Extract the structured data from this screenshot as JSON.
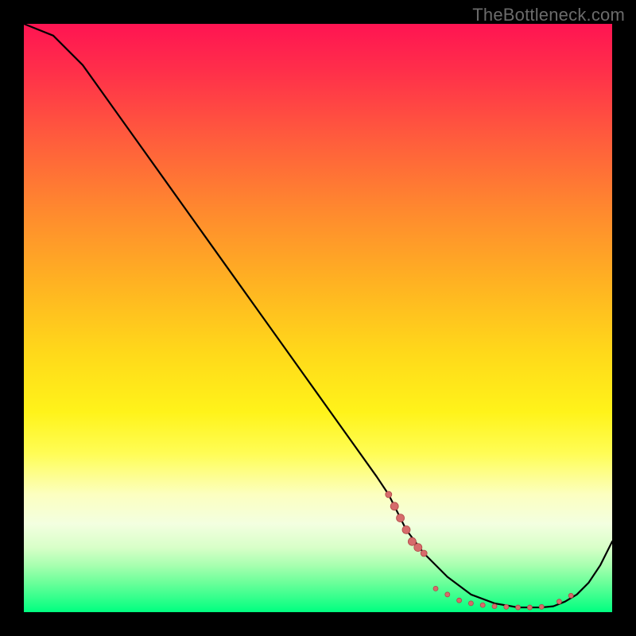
{
  "watermark": "TheBottleneck.com",
  "chart_data": {
    "type": "line",
    "title": "",
    "xlabel": "",
    "ylabel": "",
    "xlim": [
      0,
      100
    ],
    "ylim": [
      0,
      100
    ],
    "grid": false,
    "series": [
      {
        "name": "curve",
        "x": [
          0,
          5,
          10,
          15,
          20,
          25,
          30,
          35,
          40,
          45,
          50,
          55,
          60,
          62,
          65,
          68,
          72,
          76,
          80,
          84,
          88,
          90,
          92,
          94,
          96,
          98,
          100
        ],
        "y": [
          100,
          98,
          93,
          86,
          79,
          72,
          65,
          58,
          51,
          44,
          37,
          30,
          23,
          20,
          14,
          10,
          6,
          3,
          1.5,
          0.8,
          0.8,
          1,
          1.8,
          3,
          5,
          8,
          12
        ]
      }
    ],
    "markers": {
      "name": "sweet-spot-beads",
      "color": "#d66b6b",
      "points": [
        {
          "x": 62,
          "y": 20,
          "r": 4
        },
        {
          "x": 63,
          "y": 18,
          "r": 5
        },
        {
          "x": 64,
          "y": 16,
          "r": 5
        },
        {
          "x": 65,
          "y": 14,
          "r": 5
        },
        {
          "x": 66,
          "y": 12,
          "r": 5
        },
        {
          "x": 67,
          "y": 11,
          "r": 5
        },
        {
          "x": 68,
          "y": 10,
          "r": 4
        },
        {
          "x": 70,
          "y": 4,
          "r": 3
        },
        {
          "x": 72,
          "y": 3,
          "r": 3
        },
        {
          "x": 74,
          "y": 2,
          "r": 3
        },
        {
          "x": 76,
          "y": 1.5,
          "r": 3
        },
        {
          "x": 78,
          "y": 1.2,
          "r": 3
        },
        {
          "x": 80,
          "y": 1,
          "r": 3
        },
        {
          "x": 82,
          "y": 0.9,
          "r": 3
        },
        {
          "x": 84,
          "y": 0.8,
          "r": 3
        },
        {
          "x": 86,
          "y": 0.8,
          "r": 3
        },
        {
          "x": 88,
          "y": 0.9,
          "r": 3
        },
        {
          "x": 91,
          "y": 1.8,
          "r": 3
        },
        {
          "x": 93,
          "y": 2.8,
          "r": 3
        }
      ]
    },
    "background_gradient": {
      "top": "#ff1452",
      "mid": "#ffe21a",
      "bottom": "#00ff80"
    }
  }
}
